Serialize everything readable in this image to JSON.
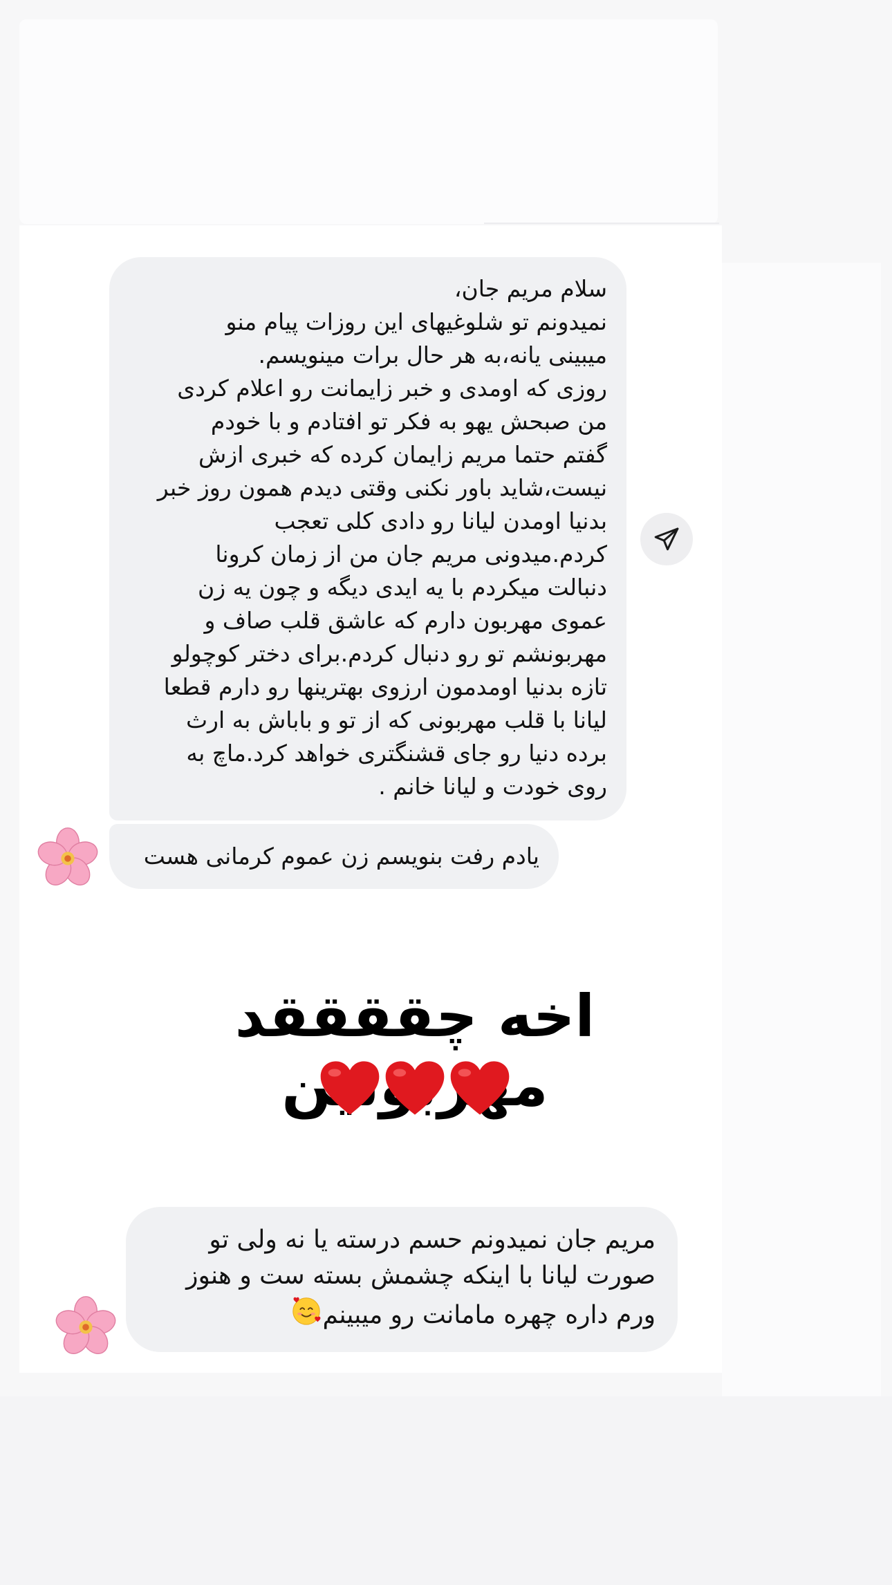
{
  "messages": [
    {
      "lines": [
        "سلام مریم جان،",
        "نمیدونم تو شلوغیهای این روزات پیام منو",
        "میبینی یانه،به هر حال برات مینویسم.",
        "روزی که اومدی و خبر زایمانت رو اعلام کردی",
        "من صبحش یهو به فکر تو افتادم و با خودم",
        "گفتم حتما مریم زایمان کرده که خبری ازش",
        "نیست،شاید باور نکنی وقتی دیدم همون روز خبر",
        "بدنیا اومدن لیانا رو دادی کلی تعجب",
        "کردم.میدونی مریم جان من از زمان کرونا",
        "دنبالت میکردم با یه ایدی دیگه و چون یه زن",
        "عموی مهربون  دارم که عاشق قلب صاف و",
        "مهربونشم تو رو دنبال کردم.برای دختر کوچولو",
        "تازه بدنیا اومدمون ارزوی بهترینها رو دارم قطعا",
        "لیانا با قلب مهربونی که از تو و باباش به ارث",
        "برده دنیا رو جای قشنگتری خواهد کرد.ماچ به",
        "روی خودت و لیانا خانم ."
      ]
    },
    {
      "text": "یادم رفت بنویسم زن عموم کرمانی هست"
    },
    {
      "lines": [
        "مریم جان نمیدونم حسم درسته یا نه ولی تو",
        "صورت لیانا با اینکه چشمش بسته ست و هنوز",
        "ورم داره چهره مامانت رو میبینم"
      ],
      "emoji": "🥰"
    }
  ],
  "overlay": {
    "caption": "اخه چققققد مهربونین",
    "hearts": [
      "❤️",
      "❤️",
      "❤️"
    ]
  },
  "icons": {
    "share": "send-icon",
    "avatar": "cherry-blossom-icon"
  },
  "colors": {
    "bubble": "#f0f1f3",
    "heart": "#e0191f",
    "flower": "#f7a8c4"
  }
}
